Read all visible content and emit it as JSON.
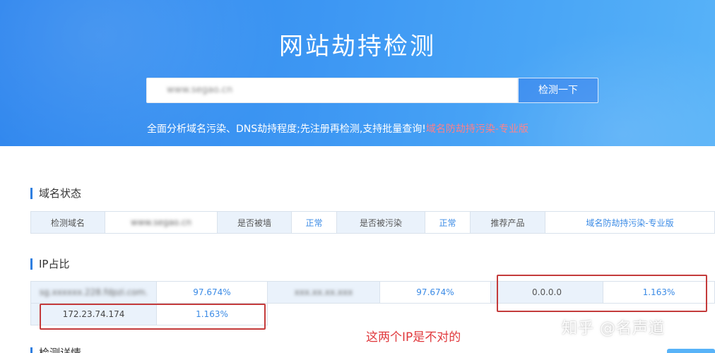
{
  "banner": {
    "title": "网站劫持检测",
    "search_value": "www.segao.cn",
    "search_button_label": "检测一下",
    "description": "全面分析域名污染、DNS劫持程度;先注册再检测,支持批量查询!",
    "description_link": "域名防劫持污染-专业版"
  },
  "domain_status": {
    "title": "域名状态",
    "cells": {
      "domain_label": "检测域名",
      "domain_value": "www.segao.cn",
      "blocked_label": "是否被墙",
      "blocked_value": "正常",
      "polluted_label": "是否被污染",
      "polluted_value": "正常",
      "product_label": "推荐产品",
      "product_value": "域名防劫持污染-专业版"
    }
  },
  "ip_ratio": {
    "title": "IP占比",
    "rows": [
      [
        {
          "ip": "sg.xxxxxx.228.fdpzi.com.",
          "ratio": "97.674%"
        },
        {
          "ip": "xxx.xx.xx.xxx",
          "ratio": "97.674%"
        },
        {
          "ip": "0.0.0.0",
          "ratio": "1.163%"
        }
      ],
      [
        {
          "ip": "172.23.74.174",
          "ratio": "1.163%"
        }
      ]
    ]
  },
  "annotation": "这两个IP是不对的",
  "watermark": "知乎 @名声道",
  "next_section_title": "检测详情",
  "colors": {
    "banner_start": "#2f86ee",
    "banner_end": "#58b3f8",
    "accent": "#2f7fe0",
    "link": "#3b8be6",
    "annotation_red": "#e0383c",
    "label_bg": "#eaf2fb"
  }
}
